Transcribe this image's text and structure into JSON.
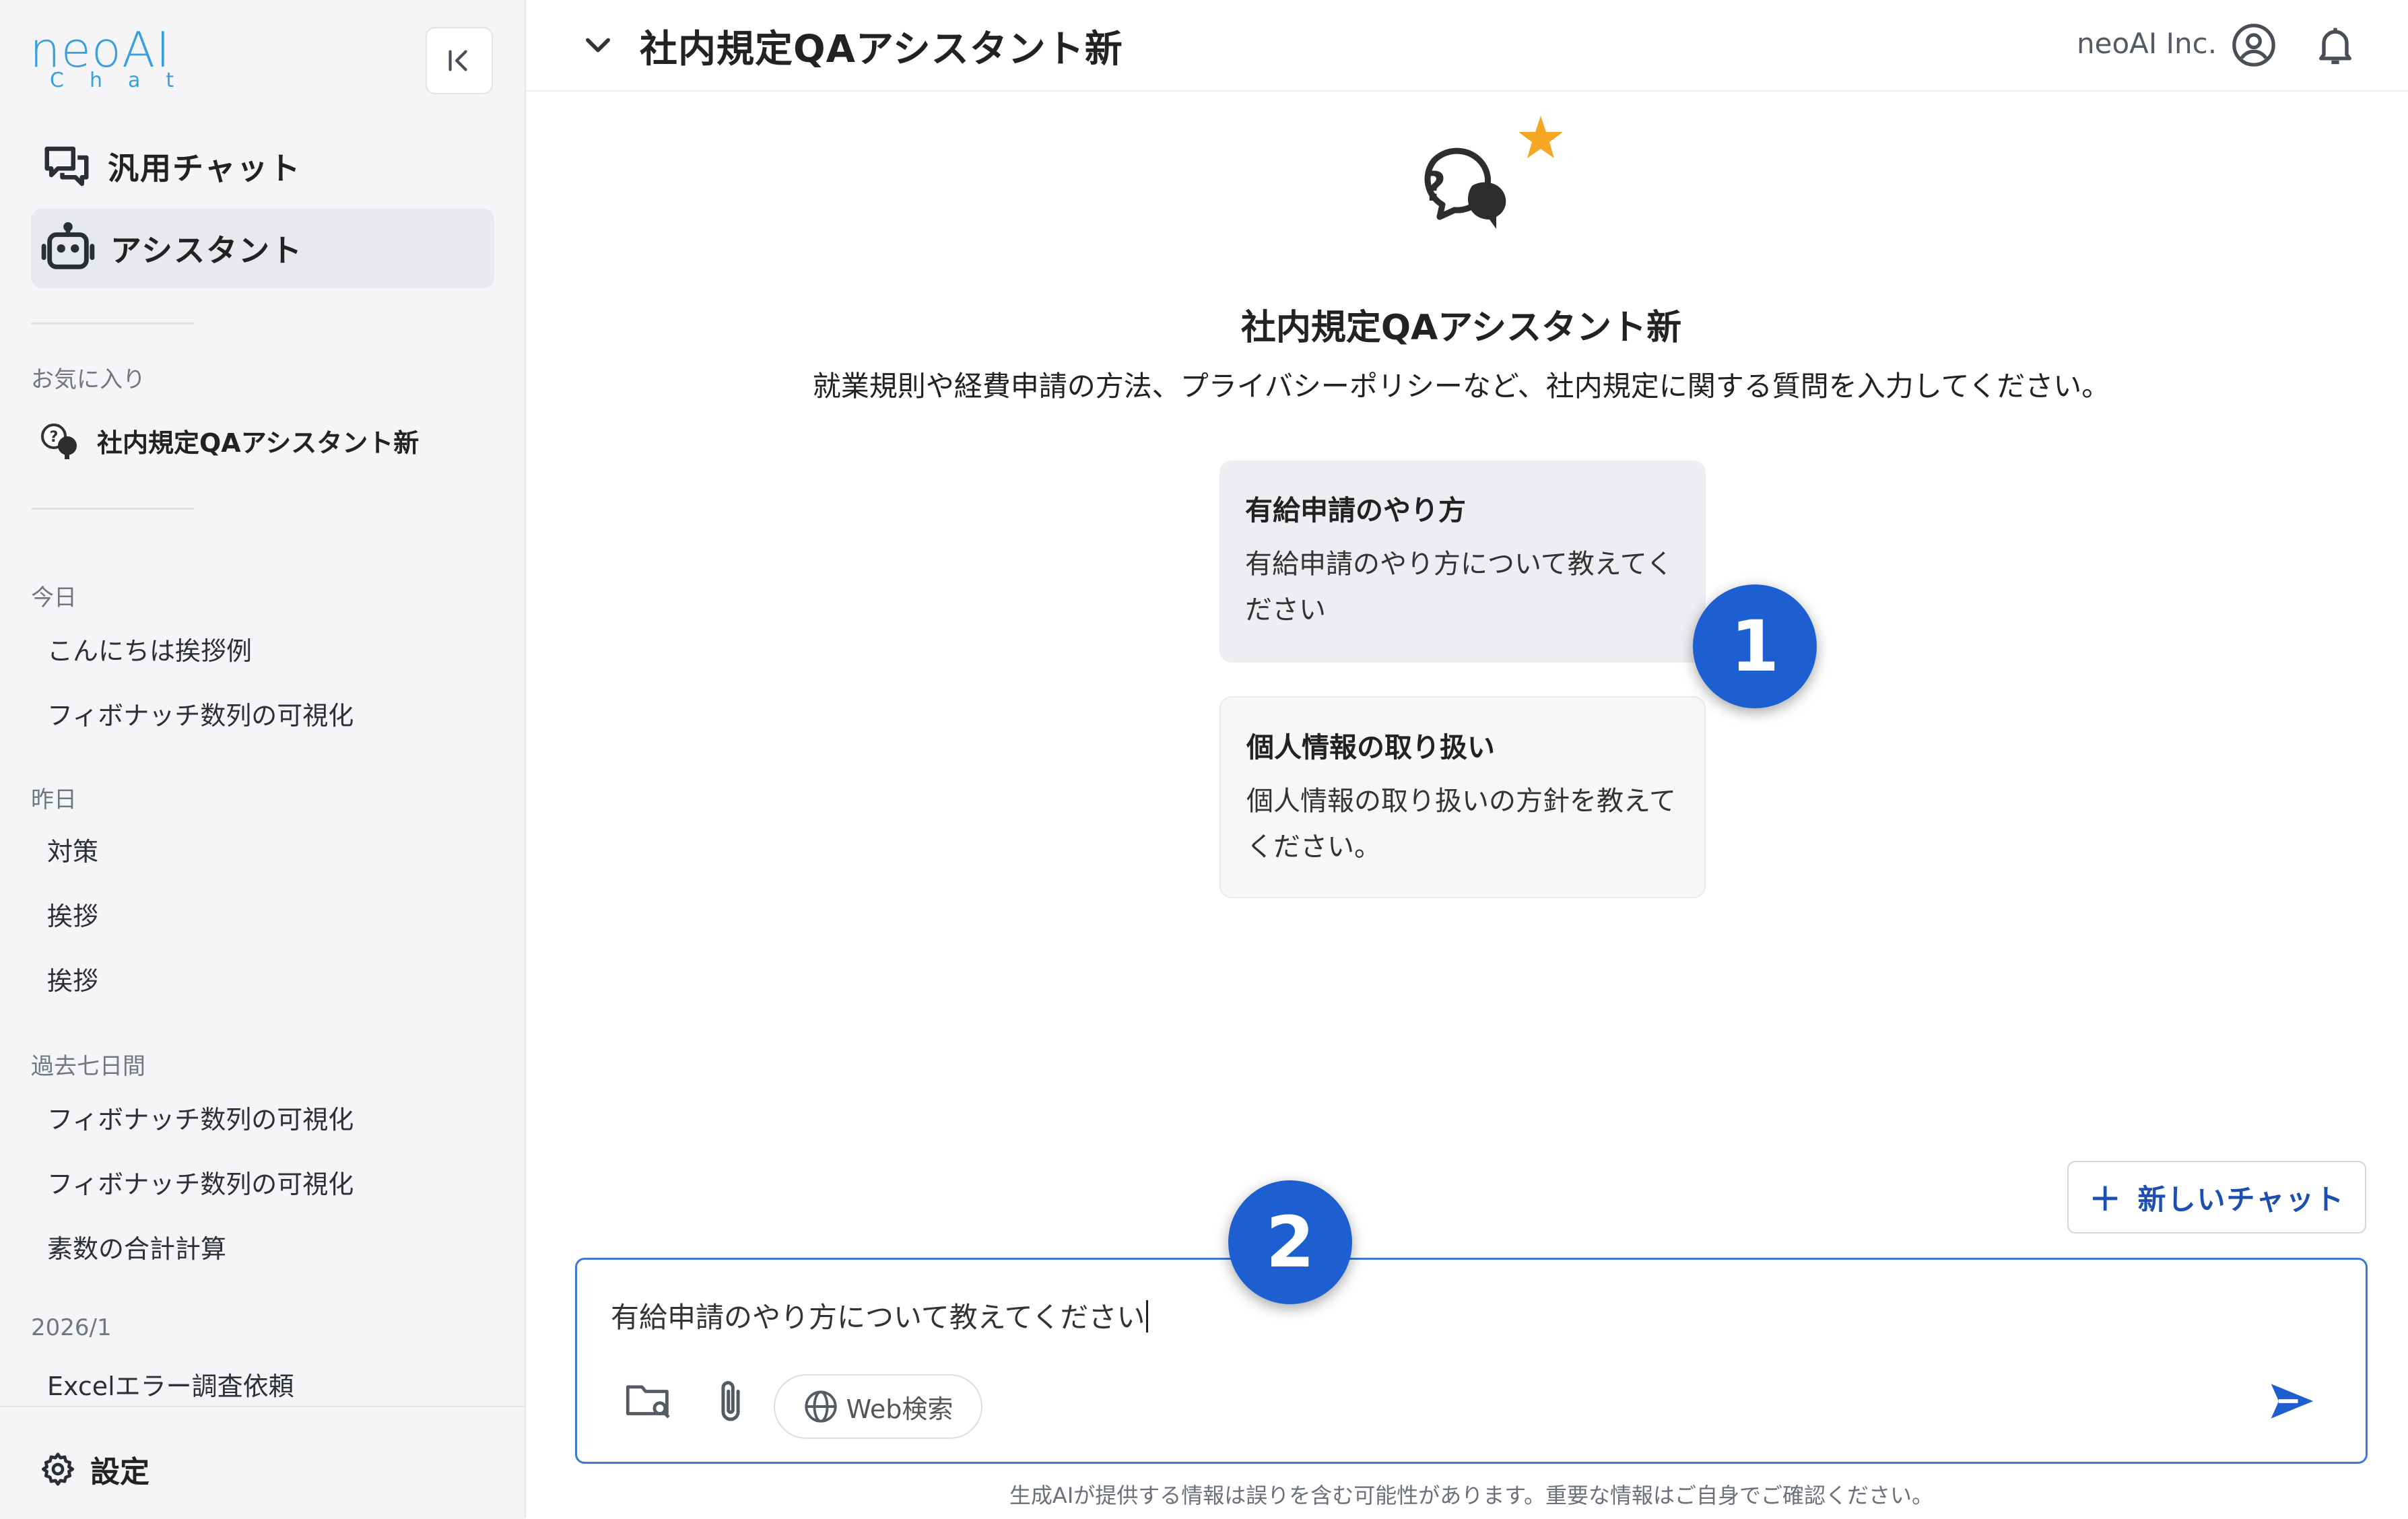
{
  "sidebar": {
    "logo_text": "neoAI",
    "logo_sub": "Chat",
    "nav": [
      {
        "label": "汎用チャット",
        "icon": "chat-bubbles-icon",
        "active": false
      },
      {
        "label": "アシスタント",
        "icon": "robot-icon",
        "active": true
      }
    ],
    "favorites_label": "お気に入り",
    "favorites": [
      {
        "label": "社内規定QAアシスタント新",
        "icon": "assistant-avatar-icon"
      }
    ],
    "history": [
      {
        "group": "今日",
        "items": [
          "こんにちは挨拶例",
          "フィボナッチ数列の可視化"
        ]
      },
      {
        "group": "昨日",
        "items": [
          "対策",
          "挨拶",
          "挨拶"
        ]
      },
      {
        "group": "過去七日間",
        "items": [
          "フィボナッチ数列の可視化",
          "フィボナッチ数列の可視化",
          "素数の合計計算"
        ]
      },
      {
        "group": "2026/1",
        "items": [
          "Excelエラー調査依頼"
        ]
      }
    ],
    "settings_label": "設定"
  },
  "header": {
    "title": "社内規定QAアシスタント新",
    "org_name": "neoAI Inc."
  },
  "main": {
    "assistant_name": "社内規定QAアシスタント新",
    "assistant_description": "就業規則や経費申請の方法、プライバシーポリシーなど、社内規定に関する質問を入力してください。",
    "suggestions": [
      {
        "title": "有給申請のやり方",
        "body": "有給申請のやり方について教えてください"
      },
      {
        "title": "個人情報の取り扱い",
        "body": "個人情報の取り扱いの方針を教えてください。"
      }
    ],
    "badges": [
      "1",
      "2"
    ],
    "new_chat_label": "新しいチャット",
    "composer": {
      "value": "有給申請のやり方について教えてください",
      "web_search_label": "Web検索"
    },
    "disclaimer": "生成AIが提供する情報は誤りを含む可能性があります。重要な情報はご自身でご確認ください。"
  },
  "colors": {
    "accent": "#1d5fd1",
    "composer_border": "#3d78d6",
    "logo": "#3aa0dd",
    "star": "#f5a623",
    "sidebar_bg": "#f5f5f7"
  }
}
